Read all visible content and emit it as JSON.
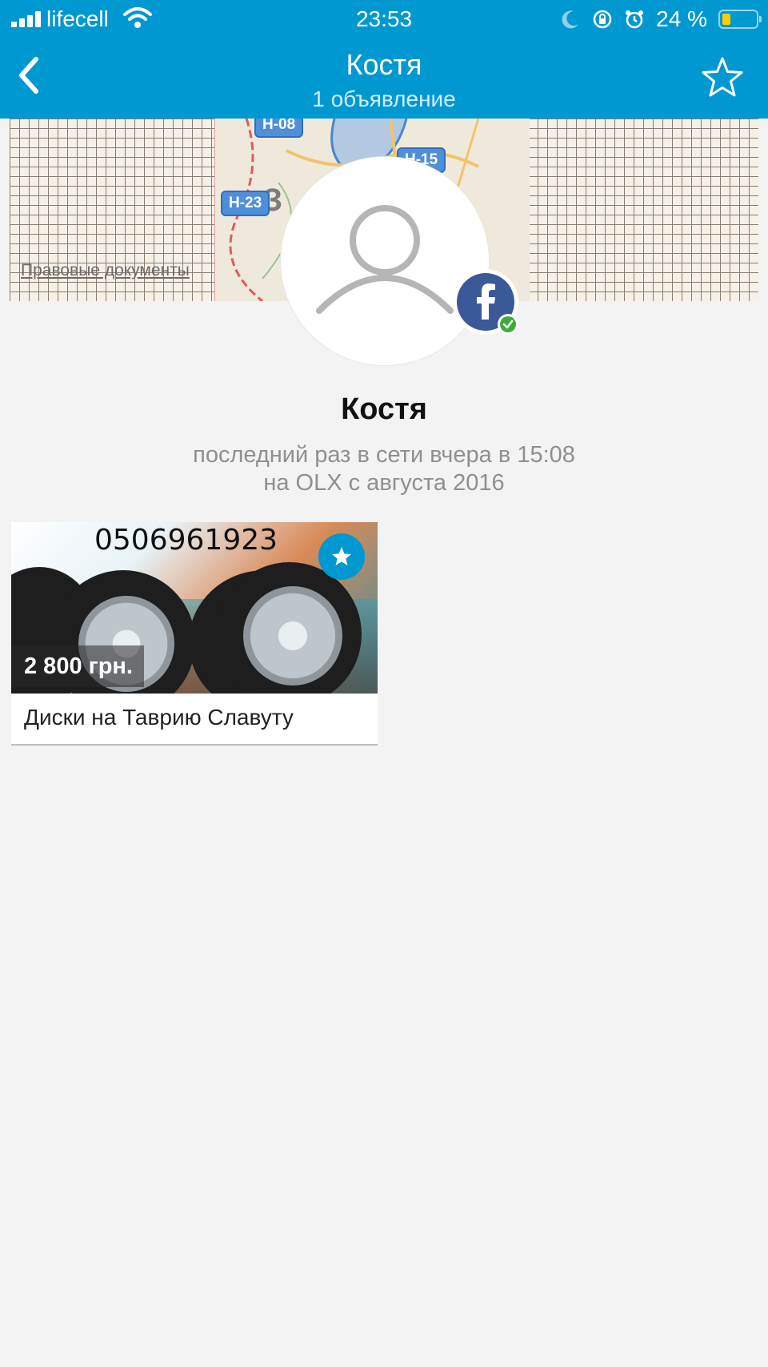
{
  "status_bar": {
    "carrier": "lifecell",
    "time": "23:53",
    "battery_percent": "24 %",
    "battery_level": 0.24,
    "icons": [
      "signal-icon",
      "wifi-icon",
      "moon-icon",
      "rotation-lock-icon",
      "alarm-icon",
      "battery-icon"
    ]
  },
  "header": {
    "title": "Костя",
    "subtitle": "1 объявление",
    "back_icon": "chevron-left-icon",
    "favorite_icon": "star-outline-icon"
  },
  "map": {
    "legal_link": "Правовые документы",
    "road_labels": [
      "H-08",
      "H-15",
      "H-23"
    ]
  },
  "profile": {
    "name": "Костя",
    "last_seen": "последний раз в сети вчера в 15:08",
    "member_since": "на OLX с августа 2016",
    "avatar_icon": "user-placeholder-icon",
    "verified_icon": "facebook-icon"
  },
  "ads": [
    {
      "phone_overlay": "0506961923",
      "price": "2 800 грн.",
      "title": "Диски на Таврию Славуту"
    }
  ],
  "colors": {
    "header_bg": "#0098d0",
    "page_bg": "#f3f3f3",
    "facebook": "#3b5998",
    "verified": "#3eab3a"
  }
}
